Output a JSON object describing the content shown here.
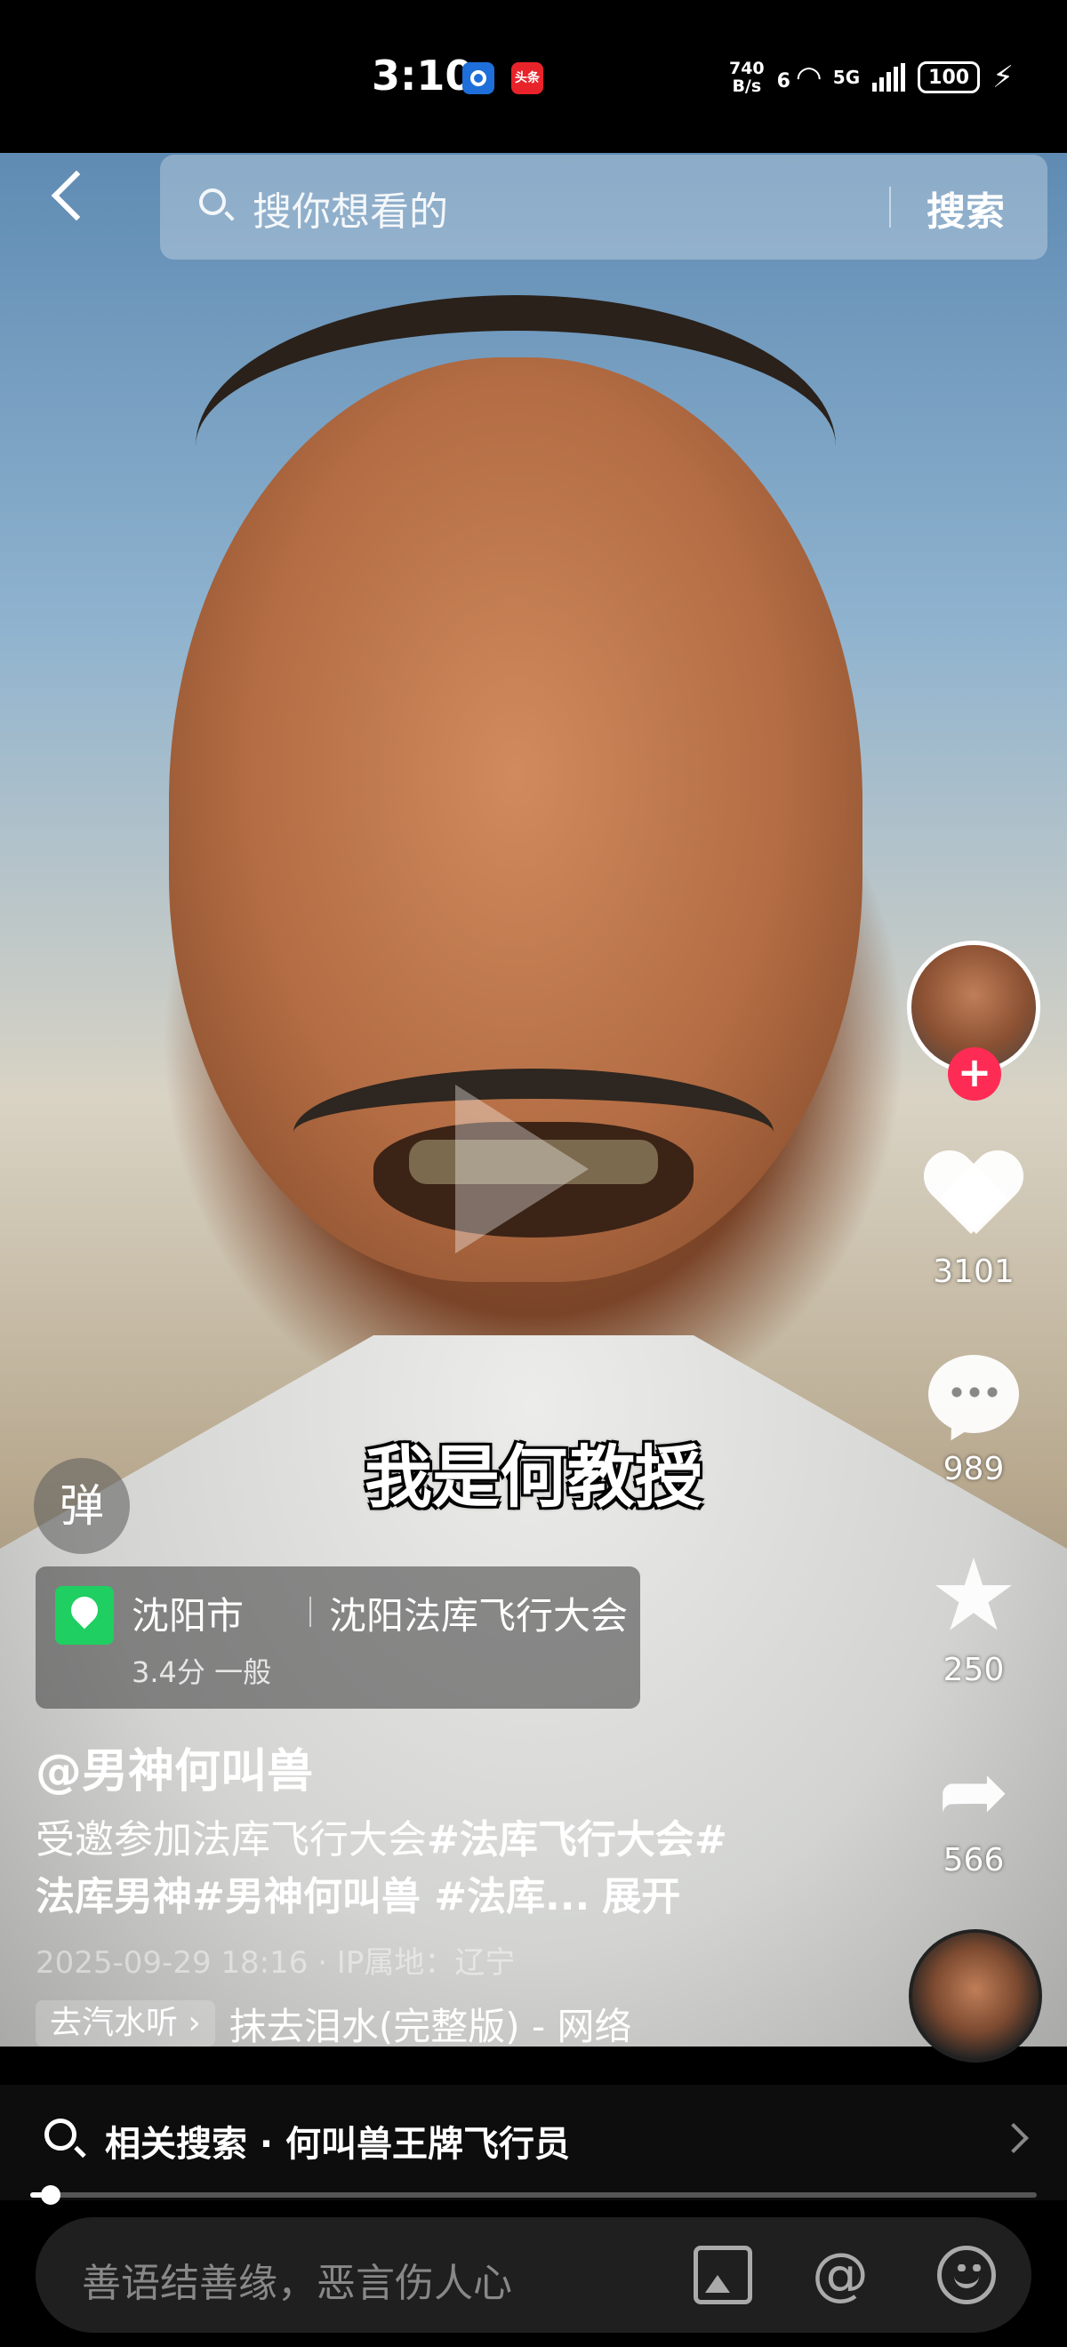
{
  "status_bar": {
    "time": "3:10",
    "app_badge": "头条",
    "net_speed_value": "740",
    "net_speed_unit": "B/s",
    "wifi_label": "6",
    "network": "5G",
    "battery": "100"
  },
  "search": {
    "placeholder": "搜你想看的",
    "button": "搜索"
  },
  "video": {
    "subtitle": "我是何教授"
  },
  "rail": {
    "likes": "3101",
    "comments": "989",
    "favorites": "250",
    "shares": "566",
    "follow": "+"
  },
  "overlay": {
    "danmu": "弹",
    "location_city": "沈阳市",
    "location_name": "沈阳法库飞行大会",
    "location_rating": "3.4分 一般",
    "author": "@男神何叫兽",
    "desc_plain": "受邀参加法库飞行大会",
    "desc_tags_1": "#法库飞行大会#",
    "desc_tags_2": "法库男神#男神何叫兽 #法库...",
    "desc_expand": "展开",
    "meta": "2025-09-29 18:16 · IP属地：辽宁",
    "music_chip": "去汽水听 ›",
    "music_title": "抹去泪水(完整版) - 网络"
  },
  "related": {
    "text": "相关搜索 · 何叫兽王牌飞行员"
  },
  "playback": {
    "progress": 0.02
  },
  "comment_bar": {
    "placeholder": "善语结善缘，恶言伤人心",
    "at_symbol": "@"
  },
  "colors": {
    "follow": "#fe2c55",
    "location_pin": "#1fcf62"
  }
}
